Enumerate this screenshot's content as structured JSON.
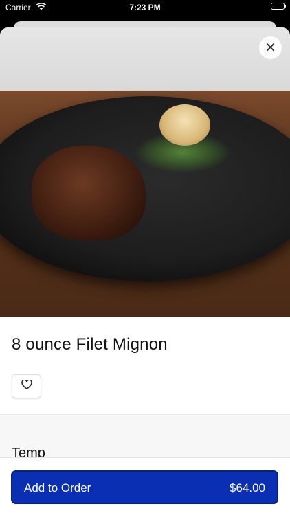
{
  "status_bar": {
    "carrier": "Carrier",
    "time": "7:23 PM",
    "icons": [
      "wifi-icon",
      "battery-icon"
    ]
  },
  "item": {
    "name": "8 ounce Filet Mignon",
    "image_alt_icon": "food-photo",
    "favorite_icon": "heart-outline-icon"
  },
  "close": {
    "label": "✕",
    "icon": "close-icon"
  },
  "options": {
    "section_title": "Temp"
  },
  "order": {
    "button_label": "Add to Order",
    "price": "$64.00",
    "accent_color": "#0a2fb3"
  }
}
